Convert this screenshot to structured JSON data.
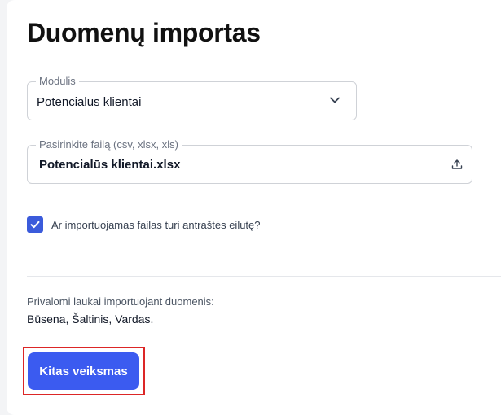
{
  "page": {
    "title": "Duomenų importas"
  },
  "module": {
    "label": "Modulis",
    "value": "Potencialūs klientai",
    "icon": "chevron-down-icon"
  },
  "file": {
    "label": "Pasirinkite failą (csv, xlsx, xls)",
    "value": "Potencialūs klientai.xlsx",
    "icon": "upload-icon"
  },
  "header_checkbox": {
    "checked": true,
    "label": "Ar importuojamas failas turi antraštės eilutę?"
  },
  "required": {
    "label": "Privalomi laukai importuojant duomenis:",
    "fields": "Būsena, Šaltinis, Vardas."
  },
  "actions": {
    "next_label": "Kitas veiksmas"
  },
  "colors": {
    "accent": "#3b5bf0",
    "highlight": "#dc2626"
  }
}
